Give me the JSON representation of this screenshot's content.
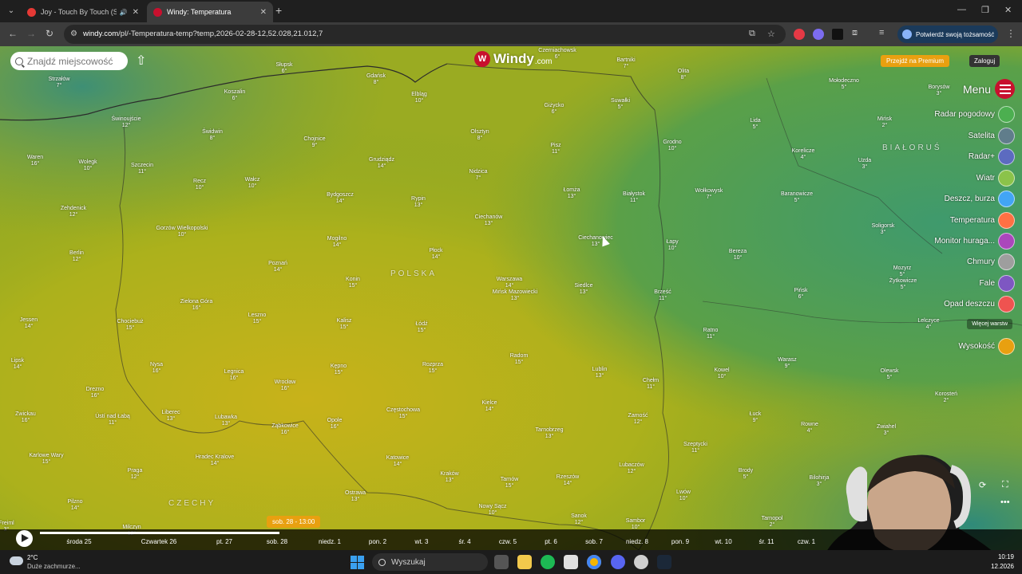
{
  "browser": {
    "tabs": [
      {
        "title": "Joy - Touch By Touch (SOU",
        "icon": "youtube-icon",
        "color": "#e53935"
      },
      {
        "title": "Windy: Temperatura",
        "icon": "windy-icon",
        "color": "#c8102e"
      }
    ],
    "url_host": "windy.com",
    "url_path": "/pl/-Temperatura-temp?temp,2026-02-28-12,52.028,21.012,7",
    "verify_label": "Potwierdź swoją tożsamość"
  },
  "windy": {
    "search_placeholder": "Znajdź miejscowość",
    "logo_name": "Windy",
    "logo_domain": ".com",
    "premium_label": "Przejdź na Premium",
    "login_label": "Zaloguj",
    "menu_label": "Menu",
    "layers": [
      {
        "label": "Radar pogodowy",
        "color": "#4caf50"
      },
      {
        "label": "Satelita",
        "color": "#607d8b"
      },
      {
        "label": "Radar+",
        "color": "#5c6bc0"
      },
      {
        "label": "Wiatr",
        "color": "#8bc34a"
      },
      {
        "label": "Deszcz, burza",
        "color": "#42a5f5"
      },
      {
        "label": "Temperatura",
        "color": "#ff7043"
      },
      {
        "label": "Monitor huragа...",
        "color": "#ab47bc"
      },
      {
        "label": "Chmury",
        "color": "#9e9e9e"
      },
      {
        "label": "Fale",
        "color": "#7e57c2"
      },
      {
        "label": "Opad deszczu",
        "color": "#ef5350"
      }
    ],
    "more_layers": "Więcej warstw",
    "altitude_label": "Wysokość",
    "time_label": "sob. 28 - 13:00",
    "countries": [
      "POLSKA",
      "CZECHY",
      "BIAŁORUŚ"
    ],
    "cities": [
      {
        "n": "Czerniachowsk",
        "t": "6°"
      },
      {
        "n": "Bartniki",
        "t": "7°"
      },
      {
        "n": "Olita",
        "t": "8°"
      },
      {
        "n": "Mołodeczno",
        "t": "5°"
      },
      {
        "n": "Borysów",
        "t": "3°"
      },
      {
        "n": "Słupsk",
        "t": "6°"
      },
      {
        "n": "Gdańsk",
        "t": "8°"
      },
      {
        "n": "Elbląg",
        "t": "10°"
      },
      {
        "n": "Giżycko",
        "t": "6°"
      },
      {
        "n": "Suwałki",
        "t": "5°"
      },
      {
        "n": "Koszalin",
        "t": "6°"
      },
      {
        "n": "Strzałów",
        "t": "7°"
      },
      {
        "n": "Świnoujście",
        "t": "12°"
      },
      {
        "n": "Olsztyn",
        "t": "8°"
      },
      {
        "n": "Lida",
        "t": "5°"
      },
      {
        "n": "Mińsk",
        "t": "2°"
      },
      {
        "n": "Świdwin",
        "t": "8°"
      },
      {
        "n": "Chojnice",
        "t": "9°"
      },
      {
        "n": "Pisz",
        "t": "11°"
      },
      {
        "n": "Grodno",
        "t": "10°"
      },
      {
        "n": "Korelicze",
        "t": "4°"
      },
      {
        "n": "Uzda",
        "t": "3°"
      },
      {
        "n": "Waren",
        "t": "16°"
      },
      {
        "n": "Wolegk",
        "t": "10°"
      },
      {
        "n": "Szczecin",
        "t": "11°"
      },
      {
        "n": "Grudziądz",
        "t": "14°"
      },
      {
        "n": "Nidzica",
        "t": "7°"
      },
      {
        "n": "Recz",
        "t": "10°"
      },
      {
        "n": "Wałcz",
        "t": "10°"
      },
      {
        "n": "Łomża",
        "t": "13°"
      },
      {
        "n": "Białystok",
        "t": "11°"
      },
      {
        "n": "Wołkowysk",
        "t": "7°"
      },
      {
        "n": "Baranowicze",
        "t": "5°"
      },
      {
        "n": "Zehdenick",
        "t": "12°"
      },
      {
        "n": "Bydgoszcz",
        "t": "14°"
      },
      {
        "n": "Rypin",
        "t": "13°"
      },
      {
        "n": "Ciechanów",
        "t": "13°"
      },
      {
        "n": "Gorzów Wielkopolski",
        "t": "10°"
      },
      {
        "n": "Ciechanowiec",
        "t": "13°"
      },
      {
        "n": "Soligorsk",
        "t": "3°"
      },
      {
        "n": "Mogilno",
        "t": "14°"
      },
      {
        "n": "Płock",
        "t": "14°"
      },
      {
        "n": "Łapy",
        "t": "10°"
      },
      {
        "n": "Bereza",
        "t": "10°"
      },
      {
        "n": "Berlin",
        "t": "12°"
      },
      {
        "n": "Poznań",
        "t": "14°"
      },
      {
        "n": "Warszawa",
        "t": "14°"
      },
      {
        "n": "Mińsk Mazowiecki",
        "t": "13°"
      },
      {
        "n": "Siedlce",
        "t": "13°"
      },
      {
        "n": "Brześć",
        "t": "11°"
      },
      {
        "n": "Pińsk",
        "t": "6°"
      },
      {
        "n": "Żytkowicze",
        "t": "5°"
      },
      {
        "n": "Konin",
        "t": "15°"
      },
      {
        "n": "Jessen",
        "t": "14°"
      },
      {
        "n": "Chociebuż",
        "t": "15°"
      },
      {
        "n": "Zielona Góra",
        "t": "16°"
      },
      {
        "n": "Leszno",
        "t": "15°"
      },
      {
        "n": "Kalisz",
        "t": "15°"
      },
      {
        "n": "Łódź",
        "t": "15°"
      },
      {
        "n": "Ratno",
        "t": "11°"
      },
      {
        "n": "Lelczyce",
        "t": "4°"
      },
      {
        "n": "Radom",
        "t": "15°"
      },
      {
        "n": "Lipsk",
        "t": "14°"
      },
      {
        "n": "Nysa",
        "t": "16°"
      },
      {
        "n": "Legnica",
        "t": "16°"
      },
      {
        "n": "Kępno",
        "t": "15°"
      },
      {
        "n": "Rozprza",
        "t": "15°"
      },
      {
        "n": "Lublin",
        "t": "13°"
      },
      {
        "n": "Kowel",
        "t": "10°"
      },
      {
        "n": "Warasz",
        "t": "9°"
      },
      {
        "n": "Olewsk",
        "t": "5°"
      },
      {
        "n": "Drezno",
        "t": "16°"
      },
      {
        "n": "Wrocław",
        "t": "16°"
      },
      {
        "n": "Chełm",
        "t": "11°"
      },
      {
        "n": "Kielce",
        "t": "14°"
      },
      {
        "n": "Częstochowa",
        "t": "15°"
      },
      {
        "n": "Łuck",
        "t": "9°"
      },
      {
        "n": "Rowne",
        "t": "4°"
      },
      {
        "n": "Zwiahel",
        "t": "3°"
      },
      {
        "n": "Korosteń",
        "t": "2°"
      },
      {
        "n": "Zwickau",
        "t": "16°"
      },
      {
        "n": "Ústí nad Łabą",
        "t": "11°"
      },
      {
        "n": "Liberec",
        "t": "13°"
      },
      {
        "n": "Lubawka",
        "t": "13°"
      },
      {
        "n": "Opole",
        "t": "16°"
      },
      {
        "n": "Ząbkowice",
        "t": "16°"
      },
      {
        "n": "Tarnobrzeg",
        "t": "13°"
      },
      {
        "n": "Zamość",
        "t": "12°"
      },
      {
        "n": "Szeptycki",
        "t": "11°"
      },
      {
        "n": "Karlowe Wary",
        "t": "15°"
      },
      {
        "n": "Praga",
        "t": "12°"
      },
      {
        "n": "Hradec Kralove",
        "t": "14°"
      },
      {
        "n": "Katowice",
        "t": "14°"
      },
      {
        "n": "Kraków",
        "t": "13°"
      },
      {
        "n": "Tarnów",
        "t": "15°"
      },
      {
        "n": "Rzeszów",
        "t": "14°"
      },
      {
        "n": "Lubaczów",
        "t": "12°"
      },
      {
        "n": "Brody",
        "t": "5°"
      },
      {
        "n": "Pilzno",
        "t": "14°"
      },
      {
        "n": "Ostrawa",
        "t": "13°"
      },
      {
        "n": "Nowy Sącz",
        "t": "10°"
      },
      {
        "n": "Sanok",
        "t": "12°"
      },
      {
        "n": "Lwów",
        "t": "10°"
      },
      {
        "n": "Tarnopol",
        "t": "2°"
      },
      {
        "n": "Bilohirja",
        "t": "3°"
      },
      {
        "n": "Sambor",
        "t": "10°"
      },
      {
        "n": "Mozyrz",
        "t": "5°"
      },
      {
        "n": "Freiml",
        "t": "3°"
      },
      {
        "n": "Milczyn",
        "t": "12°"
      }
    ]
  },
  "timeline": {
    "days": [
      "środa 25",
      "Czwartek 26",
      "pt. 27",
      "sob. 28",
      "niedz. 1",
      "pon. 2",
      "wt. 3",
      "śr. 4",
      "czw. 5",
      "pt. 6",
      "sob. 7",
      "niedz. 8",
      "pon. 9",
      "wt. 10",
      "śr. 11",
      "czw. 1"
    ],
    "progress": 0.27
  },
  "taskbar": {
    "weather_temp": "2°C",
    "weather_desc": "Duże zachmurze...",
    "search_label": "Wyszukaj",
    "time": "10:19",
    "date": "12.2026"
  }
}
